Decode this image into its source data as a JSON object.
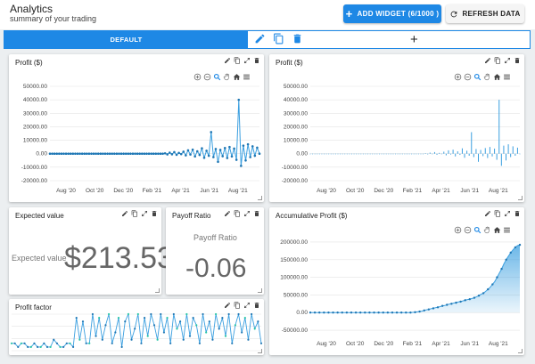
{
  "header": {
    "title": "Analytics",
    "subtitle": "summary of your trading",
    "add_widget_label": "ADD WIDGET (6/1000 )",
    "refresh_label": "REFRESH DATA"
  },
  "tabs": {
    "active_label": "DEFAULT",
    "add_label": "+"
  },
  "colors": {
    "accent": "#1e88e5",
    "series": "#3a9fe0",
    "marker": "#1f77b4"
  },
  "widgets": {
    "profit_left": {
      "title": "Profit ($)"
    },
    "profit_right": {
      "title": "Profit ($)"
    },
    "expected_value": {
      "title": "Expected value",
      "label": "Expected value",
      "value": "$213.53"
    },
    "payoff_ratio": {
      "title": "Payoff Ratio",
      "label": "Payoff Ratio",
      "value": "-0.06"
    },
    "profit_factor": {
      "title": "Profit factor"
    },
    "accumulative": {
      "title": "Accumulative Profit ($)"
    }
  },
  "chart_data": [
    {
      "id": "profit-line",
      "type": "line",
      "title": "Profit ($)",
      "x": [
        "Aug '20",
        "Oct '20",
        "Dec '20",
        "Feb '21",
        "Apr '21",
        "Jun '21",
        "Aug '21"
      ],
      "ylim": [
        -20000,
        50000
      ],
      "yticks": [
        "50000.00",
        "40000.00",
        "30000.00",
        "20000.00",
        "10000.00",
        "0.00",
        "-10000.00",
        "-20000.00"
      ],
      "grid": true,
      "values": [
        0,
        0,
        0,
        0,
        0,
        0,
        0,
        0,
        0,
        0,
        0,
        0,
        0,
        0,
        0,
        0,
        0,
        0,
        0,
        0,
        0,
        0,
        0,
        0,
        0,
        0,
        0,
        0,
        0,
        0,
        0,
        0,
        0,
        0,
        0,
        0,
        0,
        0,
        0,
        0,
        0,
        0,
        0,
        0,
        0,
        0,
        0,
        0,
        0,
        0,
        300,
        -500,
        800,
        -400,
        1200,
        -800,
        600,
        -300,
        1500,
        -1200,
        2500,
        -600,
        3000,
        -2000,
        1800,
        -900,
        4000,
        -3000,
        2200,
        -1500,
        16000,
        -2500,
        3500,
        -6000,
        2800,
        -1800,
        4200,
        -3200,
        5000,
        -2000,
        3800,
        -4500,
        40000,
        -9000,
        6000,
        -5000,
        7000,
        -2500,
        5500,
        -1500,
        4500,
        0
      ]
    },
    {
      "id": "profit-bar",
      "type": "bar",
      "title": "Profit ($)",
      "x": [
        "Aug '20",
        "Oct '20",
        "Dec '20",
        "Feb '21",
        "Apr '21",
        "Jun '21",
        "Aug '21"
      ],
      "ylim": [
        -20000,
        50000
      ],
      "yticks": [
        "50000.00",
        "40000.00",
        "30000.00",
        "20000.00",
        "10000.00",
        "0.00",
        "-10000.00",
        "-20000.00"
      ],
      "grid": true,
      "values": [
        0,
        0,
        0,
        0,
        0,
        0,
        0,
        0,
        0,
        0,
        0,
        0,
        0,
        0,
        0,
        0,
        0,
        0,
        0,
        0,
        0,
        0,
        0,
        0,
        0,
        0,
        0,
        0,
        0,
        0,
        0,
        0,
        0,
        0,
        0,
        0,
        0,
        0,
        0,
        0,
        0,
        0,
        0,
        0,
        0,
        0,
        0,
        0,
        0,
        0,
        300,
        -500,
        800,
        -400,
        1200,
        -800,
        600,
        -300,
        1500,
        -1200,
        2500,
        -600,
        3000,
        -2000,
        1800,
        -900,
        4000,
        -3000,
        2200,
        -1500,
        16000,
        -2500,
        3500,
        -6000,
        2800,
        -1800,
        4200,
        -3200,
        5000,
        -2000,
        3800,
        -4500,
        40000,
        -9000,
        6000,
        -5000,
        7000,
        -2500,
        5500,
        -1500,
        4500,
        0
      ]
    },
    {
      "id": "accumulative",
      "type": "area",
      "title": "Accumulative Profit ($)",
      "x": [
        "Aug '20",
        "Oct '20",
        "Dec '20",
        "Feb '21",
        "Apr '21",
        "Jun '21",
        "Aug '21"
      ],
      "ylim": [
        -60000,
        210000
      ],
      "yticks": [
        "200000.00",
        "150000.00",
        "100000.00",
        "50000.00",
        "0.00",
        "-50000.00"
      ],
      "grid": true,
      "values": [
        0,
        0,
        0,
        0,
        0,
        0,
        0,
        0,
        0,
        0,
        0,
        0,
        0,
        0,
        0,
        0,
        0,
        0,
        0,
        0,
        0,
        0,
        0,
        0,
        0,
        0,
        0,
        0,
        0,
        0,
        0,
        0,
        0,
        0,
        0,
        0,
        0,
        0,
        0,
        0,
        0,
        0,
        0,
        0,
        0,
        500,
        1000,
        2000,
        3000,
        4000,
        6000,
        8000,
        9000,
        11000,
        12000,
        14000,
        15000,
        17000,
        19000,
        20000,
        22000,
        24000,
        25000,
        27000,
        28000,
        30000,
        31000,
        33000,
        35000,
        37000,
        38000,
        40000,
        42000,
        45000,
        48000,
        52000,
        55000,
        60000,
        66000,
        72000,
        80000,
        88000,
        100000,
        112000,
        124000,
        138000,
        150000,
        160000,
        170000,
        178000,
        185000,
        190000,
        192000
      ]
    },
    {
      "id": "profit-factor",
      "type": "line",
      "title": "Profit factor",
      "values": [
        0.2,
        0.2,
        0.1,
        0.2,
        0.2,
        0.1,
        0.1,
        0.2,
        0.1,
        0.1,
        0.2,
        0.1,
        0.1,
        0.3,
        0.2,
        0.1,
        0.1,
        0.2,
        0.2,
        0.1,
        0.9,
        0.3,
        0.8,
        0.2,
        0.2,
        1.0,
        0.4,
        0.9,
        0.3,
        0.7,
        1.0,
        0.2,
        0.5,
        0.9,
        0.1,
        0.8,
        1.0,
        0.3,
        0.6,
        1.0,
        0.2,
        0.9,
        0.4,
        1.0,
        0.7,
        0.3,
        1.0,
        0.5,
        0.9,
        0.2,
        1.0,
        0.6,
        0.8,
        0.3,
        1.0,
        0.4,
        0.9,
        0.7,
        0.2,
        1.0,
        0.5,
        0.8,
        0.3,
        1.0,
        0.6,
        0.9,
        0.4,
        1.0,
        0.2,
        0.7,
        1.0,
        0.5,
        0.9,
        0.3,
        1.0,
        0.6,
        0.8,
        0.2
      ]
    }
  ]
}
